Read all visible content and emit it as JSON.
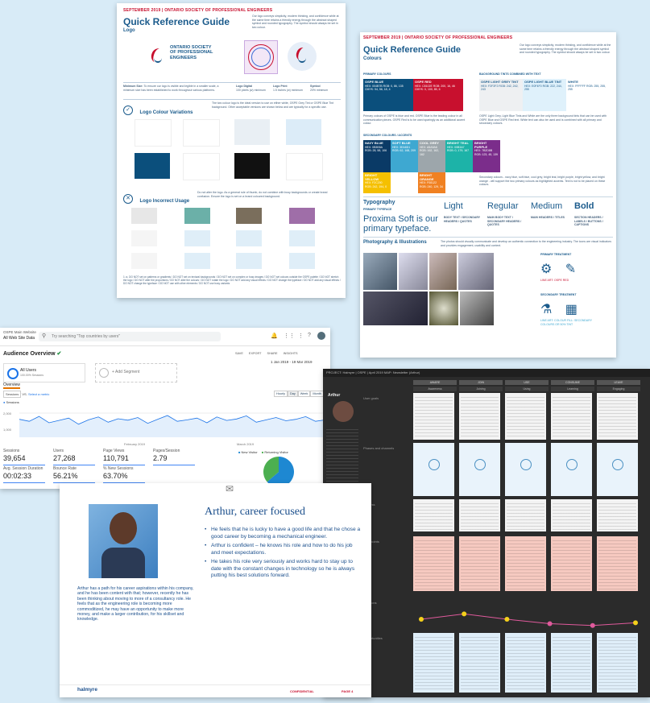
{
  "doc1": {
    "tag": "SEPTEMBER 2019 | ONTARIO SOCIETY OF PROFESSIONAL ENGINEERS",
    "title": "Quick Reference Guide",
    "subtitle": "Logo",
    "intro": "Our logo conveys simplicity, modern thinking, and confidence while at the same time retains a friendly energy through the abstract shaped symbol and rounded typography. The symbol should always be set in two colour.",
    "logo_text": "ONTARIO SOCIETY OF PROFESSIONAL ENGINEERS",
    "specs": [
      {
        "label": "Minimum Size:",
        "text": "To ensure our logo is visible and legible in a smaller scale, a minimum size has been established to work throughout various platforms."
      },
      {
        "label": "Logo Digital",
        "text": "100 pixels (w) minimum"
      },
      {
        "label": "Logo Print",
        "text": "1.5 inches (w) minimum"
      },
      {
        "label": "Symbol",
        "text": "20% minimum"
      }
    ],
    "variations_title": "Logo Colour Variations",
    "variations_text": "The two colour logo is the ideal version to use on either white, OSPE Grey Tint or OSPE Blue Tint background. Other acceptable versions are shown below and are typically for a specific use.",
    "incorrect_title": "Logo Incorrect Usage",
    "incorrect_text": "Do not alter the logo. As a general rule of thumb, do not combine with busy backgrounds or create brand confusion. Ensure the logo is set on a brand coloured background.",
    "footer_text": "1: a. DO NOT set on patterns or gradients / DO NOT set on textural backgrounds / DO NOT set on complex or busy images / DO NOT set colours outside the OSPE palette / DO NOT stretch the logo / DO NOT alter the proportions / DO NOT alter the colours / DO NOT rotate the logo / DO NOT add any visual effects / DO NOT change the typeface / DO NOT add any visual effects / DO NOT change the typeface / DO NOT use with other elements / DO NOT use busy variants"
  },
  "doc2": {
    "tag": "SEPTEMBER 2019 | ONTARIO SOCIETY OF PROFESSIONAL ENGINEERS",
    "title": "Quick Reference Guide",
    "subtitle": "Colours",
    "intro": "Our logo conveys simplicity, modern thinking, and confidence while at the same time retains a friendly energy through the abstract shaped symbol and rounded typography. The symbol should always be set in two colour.",
    "primary_label": "PRIMARY COLOURS",
    "tints_label": "BACKGROUND TINTS COMBINED WITH TEXT",
    "primary": [
      {
        "name": "OSPE BLUE",
        "codes": "HEX: 004B7B RGB: 0, 86, 135 CMYK: 94, 56, 18, 4",
        "color": "#0b4f7c"
      },
      {
        "name": "OSPE RED",
        "codes": "HEX: C8102E RGB: 200, 16, 46 CMYK: 0, 100, 85, 6",
        "color": "#c8102e"
      }
    ],
    "tints": [
      {
        "name": "OSPE LIGHT GREY TINT",
        "codes": "HEX: F2F2F2 RGB: 242, 242, 243"
      },
      {
        "name": "OSPE LIGHT BLUE TINT",
        "codes": "HEX: E0F4F0 RGB: 222, 244, 255"
      },
      {
        "name": "WHITE",
        "codes": "HEX: FFFFFF RGB: 255, 255, 255"
      }
    ],
    "primary_text": "Primary colours of OSPE is blue and red. OSPE Blue is the leading colour in all communication pieces. OSPE Red is to be used sparingly as an additional accent colour.",
    "tints_text": "OSPE Light Grey, Light Blue Tints and White are the only three background tints that can be used with OSPE Blue and OSPE Red text. White text can also be used and is combined with all primary and secondary colours.",
    "secondary_label": "SECONDARY COLOURS / ACCENTS",
    "secondary": [
      {
        "name": "NAVY BLUE",
        "codes": "HEX: 0B3B5A RGB: 28, 58, 106",
        "color": "#0a3a66"
      },
      {
        "name": "SOFT BLUE",
        "codes": "HEX: 3EA8D1 RGB: 62, 168, 209",
        "color": "#3ea8d1"
      },
      {
        "name": "COOL GREY",
        "codes": "HEX: A5A5A6 RGB: 162, 162, 162",
        "color": "#9da6ab"
      },
      {
        "name": "BRIGHT TEAL",
        "codes": "HEX: 00B3A7 RGB: 0, 179, 167",
        "color": "#1db3a8"
      },
      {
        "name": "BRIGHT PURPLE",
        "codes": "HEX: 7B2D8B RGB: 123, 45, 139",
        "color": "#7b2d8b"
      },
      {
        "name": "BRIGHT YELLOW",
        "codes": "HEX: F2C200 RGB: 242, 194, 0",
        "color": "#f5c000"
      },
      {
        "name": "BRIGHT ORANGE",
        "codes": "HEX: F08122 RGB: 240, 129, 34",
        "color": "#f08122"
      }
    ],
    "secondary_text": "Secondary colours - navy blue, soft blue, cool grey, bright teal, bright purple, bright yellow, and bright orange - will support the two primary colours as highlighted accents. Text is not to be placed on these colours.",
    "typo_title": "Typography",
    "typo_label": "PRIMARY TYPEFACE",
    "typo_big": "Proxima Soft is our primary typeface.",
    "weights": [
      {
        "name": "Light",
        "use": "BODY TEXT / SECONDARY HEADERS / QUOTES"
      },
      {
        "name": "Regular",
        "use": "MAIN BODY TEXT / SECONDARY HEADERS / QUOTES"
      },
      {
        "name": "Medium",
        "use": "MAIN HEADERS / TITLES"
      },
      {
        "name": "Bold",
        "use": "SECTION HEADERS / LABELS / BUTTONS / CAPTIONS"
      }
    ],
    "photo_title": "Photography & Illustrations",
    "photo_text": "The photos should visually communicate and develop an authentic connection to the engineering industry. The icons are visual indicators and provides engagement, usability and context.",
    "primary_treatment": "PRIMARY TREATMENT",
    "secondary_treatment": "SECONDARY TREATMENT",
    "treat1_note": "LINE ART: OSPE RED",
    "treat2_note": "LINE ART: COLOUR FILL: SECONDARY COLOURS OR 50% TINT"
  },
  "analytics": {
    "breadcrumb": "OSPE Main Website",
    "view": "All Web Site Data",
    "search_placeholder": "Try searching \"Top countries by users\"",
    "title": "Audience Overview",
    "actions": [
      "SAVE",
      "EXPORT",
      "SHARE",
      "INSIGHTS"
    ],
    "date_range": "1 Jan 2019 - 19 Mar 2019",
    "segment_name": "All Users",
    "segment_sub": "100.00% Sessions",
    "add_segment": "+ Add Segment",
    "tab": "Overview",
    "metric_select": "Sessions",
    "vs": "VS.",
    "select_metric": "Select a metric",
    "granularity": [
      "Hourly",
      "Day",
      "Week",
      "Month"
    ],
    "legend_series": "Sessions",
    "y_ticks": [
      "2,000",
      "1,000"
    ],
    "x_labels": [
      "February 2019",
      "March 2019"
    ],
    "metrics": [
      {
        "label": "Sessions",
        "value": "39,654"
      },
      {
        "label": "Users",
        "value": "27,268"
      },
      {
        "label": "Page Views",
        "value": "110,791"
      },
      {
        "label": "Pages/Session",
        "value": "2.79"
      },
      {
        "label": "Avg. Session Duration",
        "value": "00:02:33"
      },
      {
        "label": "Bounce Rate",
        "value": "56.21%"
      },
      {
        "label": "% New Sessions",
        "value": "63.70%"
      }
    ],
    "pie_legend": [
      "New Visitor",
      "Returning Visitor"
    ],
    "pie_shares": [
      0.637,
      0.363
    ],
    "pie_colors": [
      "#1e88d2",
      "#4caf50"
    ],
    "series_points": [
      0.62,
      0.55,
      0.72,
      0.5,
      0.58,
      0.66,
      0.45,
      0.6,
      0.7,
      0.52,
      0.64,
      0.59,
      0.68,
      0.48,
      0.62,
      0.75,
      0.55,
      0.6,
      0.66,
      0.5,
      0.7,
      0.58,
      0.63,
      0.74,
      0.52,
      0.6,
      0.68,
      0.57,
      0.62,
      0.71,
      0.55,
      0.6
    ]
  },
  "journey": {
    "header": "PROJECT: Halmyre | OSPE | April 2019   MAP: Newsletter (Arthur)",
    "stages": [
      "AWARE",
      "JOIN",
      "USE",
      "CONSUME",
      "LEAVE"
    ],
    "sub_stages": [
      "Awareness",
      "Joining",
      "Using",
      "Learning",
      "Engaging"
    ],
    "persona_name": "Arthur",
    "row_labels": [
      "User goals",
      "Phases and channels",
      "Process",
      "Pain points",
      "Emotions",
      "Opportunities"
    ],
    "emotion_scores": [
      0.5,
      0.2,
      0.5,
      0.75,
      0.85,
      0.7
    ]
  },
  "persona": {
    "title": "Arthur, career focused",
    "bullets": [
      "He feels that he is lucky to have a good life and that he chose a good career by becoming a mechanical engineer.",
      "Arthur is confident – he knows his role and how to do his job and meet expectations.",
      "He takes his role very seriously and works hard to stay up to date with the constant changes in technology so he is always putting his best solutions forward."
    ],
    "bio": "Arthur has a path for his career aspirations within his company, and he has been content with that; however, recently he has been thinking about moving to more of a consultancy role. He feels that as the engineering role is becoming more commoditized, he may have an opportunity to make more money, and make a larger contribution, for his skillset and knowledge.",
    "brand": "halmyre",
    "confidential": "CONFIDENTIAL",
    "page": "PAGE 4"
  }
}
